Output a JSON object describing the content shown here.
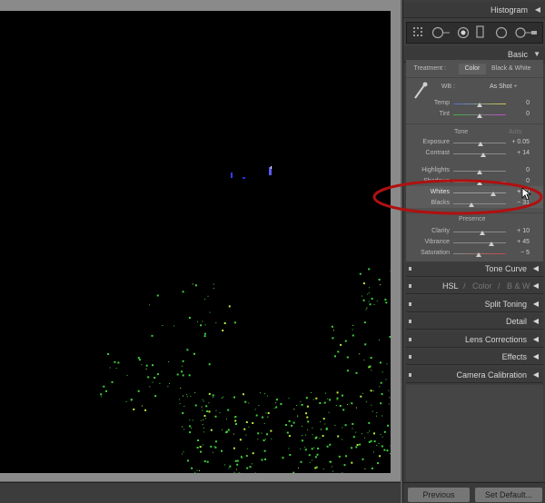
{
  "panels": {
    "histogram": "Histogram",
    "basic": "Basic"
  },
  "treatment": {
    "label": "Treatment :",
    "color": "Color",
    "bw": "Black & White"
  },
  "wb": {
    "label": "WB :",
    "value": "As Shot ÷"
  },
  "sliders": {
    "temp": {
      "label": "Temp",
      "value": "0",
      "level": 0.5
    },
    "tint": {
      "label": "Tint",
      "value": "0",
      "level": 0.5
    },
    "exposure": {
      "label": "Exposure",
      "value": "+ 0.05",
      "level": 0.51
    },
    "contrast": {
      "label": "Contrast",
      "value": "+ 14",
      "level": 0.57
    },
    "highlights": {
      "label": "Highlights",
      "value": "0",
      "level": 0.5
    },
    "shadows": {
      "label": "Shadows",
      "value": "0",
      "level": 0.5
    },
    "whites": {
      "label": "Whites",
      "value": "+ 50",
      "level": 0.75
    },
    "blacks": {
      "label": "Blacks",
      "value": "− 31",
      "level": 0.35
    },
    "clarity": {
      "label": "Clarity",
      "value": "+ 10",
      "level": 0.55
    },
    "vibrance": {
      "label": "Vibrance",
      "value": "+ 45",
      "level": 0.72
    },
    "saturation": {
      "label": "Saturation",
      "value": "− 5",
      "level": 0.48
    }
  },
  "tone": {
    "label": "Tone",
    "auto": "Auto"
  },
  "presence": "Presence",
  "sections": {
    "tone_curve": "Tone Curve",
    "hsl": "HSL",
    "hsl_sep": "/",
    "hsl_color": "Color",
    "hsl_bw": "B & W",
    "split_toning": "Split Toning",
    "detail": "Detail",
    "lens_corrections": "Lens Corrections",
    "effects": "Effects",
    "camera_calibration": "Camera Calibration"
  },
  "buttons": {
    "previous": "Previous",
    "set_default": "Set Default..."
  },
  "colors": {
    "highlight_ring": "#b01010",
    "clip_green": "#3ed13e",
    "clip_blue": "#3a3aff"
  },
  "icons": {
    "triangle_left": "◀",
    "triangle_down": "▼"
  }
}
